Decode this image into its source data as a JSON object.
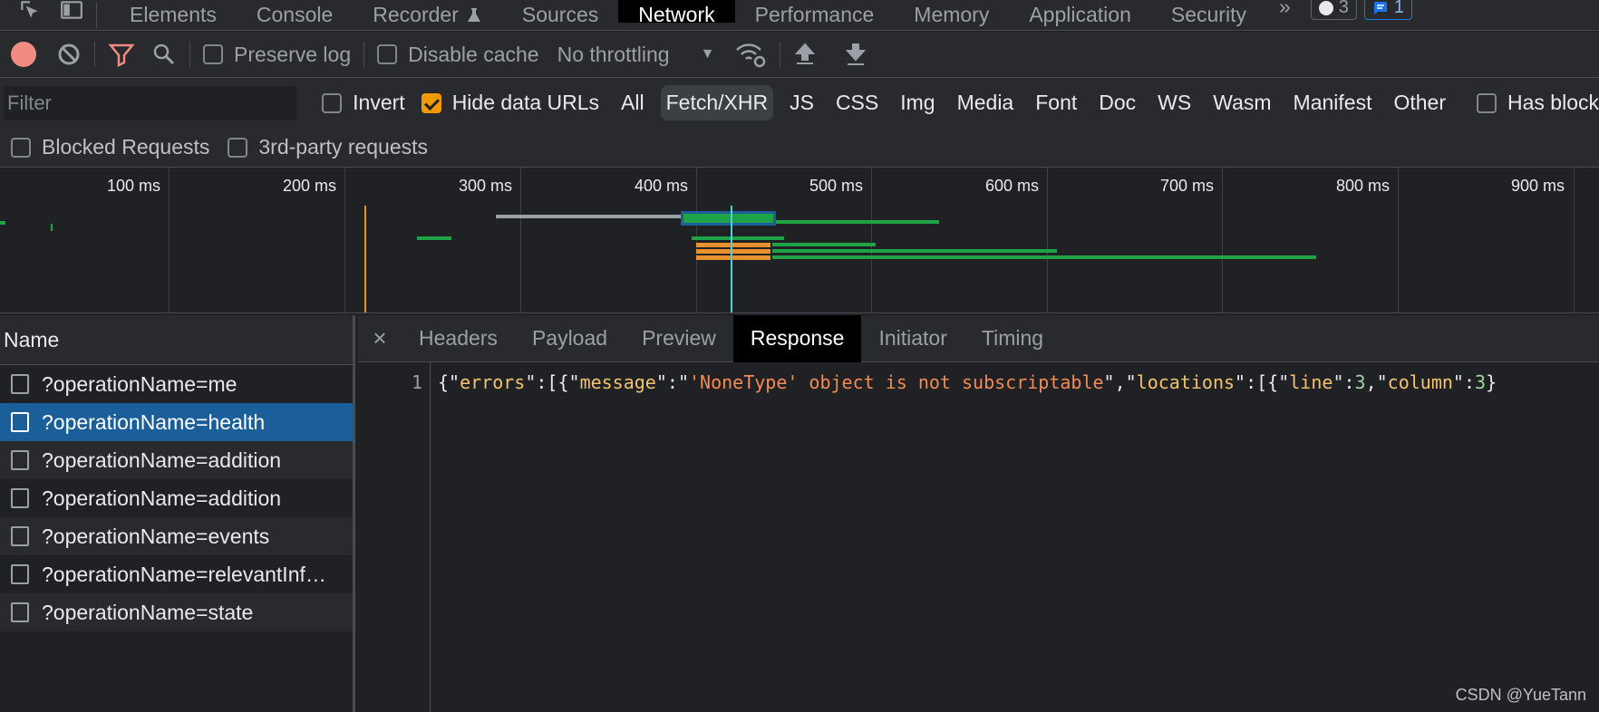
{
  "tabs": {
    "items": [
      "Elements",
      "Console",
      "Recorder",
      "Sources",
      "Network",
      "Performance",
      "Memory",
      "Application",
      "Security"
    ],
    "active": "Network",
    "more": "»",
    "issues_count": "3",
    "messages_count": "1"
  },
  "toolbar": {
    "preserve_log": "Preserve log",
    "disable_cache": "Disable cache",
    "throttling": "No throttling"
  },
  "filter": {
    "placeholder": "Filter",
    "invert": "Invert",
    "hide_data_urls": "Hide data URLs",
    "types": [
      "All",
      "Fetch/XHR",
      "JS",
      "CSS",
      "Img",
      "Media",
      "Font",
      "Doc",
      "WS",
      "Wasm",
      "Manifest",
      "Other"
    ],
    "active_type": "Fetch/XHR",
    "has_blocked": "Has block",
    "blocked_requests": "Blocked Requests",
    "third_party": "3rd-party requests"
  },
  "overview": {
    "ticks": [
      "100 ms",
      "200 ms",
      "300 ms",
      "400 ms",
      "500 ms",
      "600 ms",
      "700 ms",
      "800 ms",
      "900 ms"
    ]
  },
  "requests": {
    "header": "Name",
    "rows": [
      "?operationName=me",
      "?operationName=health",
      "?operationName=addition",
      "?operationName=addition",
      "?operationName=events",
      "?operationName=relevantInf…",
      "?operationName=state"
    ],
    "selected_index": 1
  },
  "detail": {
    "tabs": [
      "Headers",
      "Payload",
      "Preview",
      "Response",
      "Initiator",
      "Timing"
    ],
    "active": "Response",
    "line_number": "1",
    "response_tokens": [
      "{\"",
      "errors",
      "\":[{\"",
      "message",
      "\":\"",
      "'NoneType' object is not subscriptable",
      "\",\"",
      "locations",
      "\":[{\"",
      "line",
      "\":",
      "3",
      ",\"",
      "column",
      "\":",
      "3",
      "}"
    ]
  },
  "watermark": "CSDN @YueTann",
  "colors": {
    "accent_blue": "#1a73e8",
    "selected_row": "#1a5f99",
    "record_red": "#f28b82",
    "checkbox_orange": "#f29900",
    "timeline_green": "#1ea446",
    "timeline_orange": "#e8912d"
  }
}
